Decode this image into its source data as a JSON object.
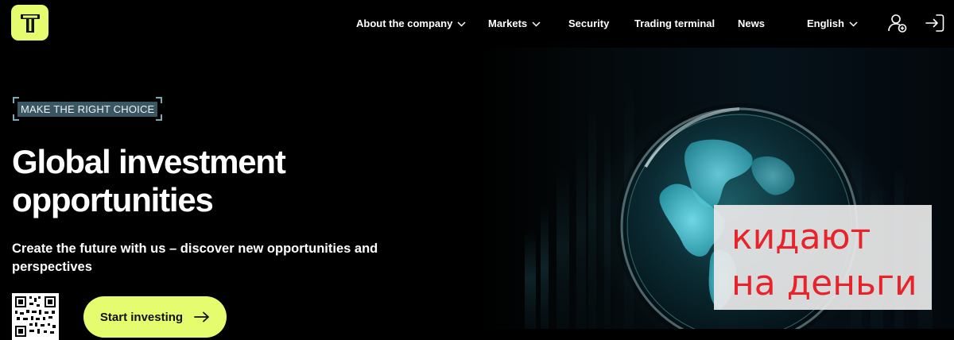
{
  "header": {
    "nav": [
      {
        "label": "About the company",
        "has_dropdown": true
      },
      {
        "label": "Markets",
        "has_dropdown": true
      },
      {
        "label": "Security",
        "has_dropdown": false
      },
      {
        "label": "Trading terminal",
        "has_dropdown": false
      },
      {
        "label": "News",
        "has_dropdown": false
      }
    ],
    "language": "English",
    "icons": {
      "logo": "t-logo-icon",
      "register": "user-add-icon",
      "login": "sign-in-icon"
    }
  },
  "hero": {
    "tag": "MAKE THE RIGHT CHOICE",
    "title_line1": "Global investment",
    "title_line2": "opportunities",
    "subtitle_line1": "Create the future with us – discover new opportunities and",
    "subtitle_line2": "perspectives",
    "cta_label": "Start investing",
    "cta_icon": "arrow-right-icon",
    "qr_icon": "qr-code-icon",
    "visual": "glass-globe-image"
  },
  "overlay": {
    "line1": "кидают",
    "line2": "на деньги"
  },
  "colors": {
    "accent": "#e6fc6f",
    "background": "#000000",
    "tag_bg": "#3b5663",
    "overlay_text": "#e8232a",
    "overlay_bg": "#e8e8e8"
  }
}
